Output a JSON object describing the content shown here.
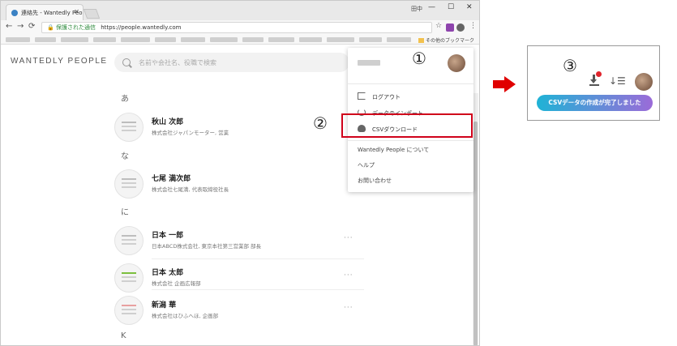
{
  "browser": {
    "tab_title": "連絡先 - Wantedly People",
    "user_label": "田中",
    "secure_label": "保護された通信",
    "url": "https://people.wantedly.com",
    "bookmark_folder": "その他のブックマーク"
  },
  "app": {
    "logo": "WANTEDLY PEOPLE",
    "search_placeholder": "名前や会社名、役職で検索"
  },
  "sections": [
    {
      "letter": "あ",
      "contacts": [
        {
          "name": "秋山 次郎",
          "company": "株式会社ジャパンモーター, 営業"
        }
      ]
    },
    {
      "letter": "な",
      "contacts": [
        {
          "name": "七尾 満次郎",
          "company": "株式会社七尾満, 代表取締役社長"
        }
      ]
    },
    {
      "letter": "に",
      "contacts": [
        {
          "name": "日本 一郎",
          "company": "日本ABCD株式会社, 東京本社第三営業部 部長"
        },
        {
          "name": "日本 太郎",
          "company": "株式会社 企画広報部"
        },
        {
          "name": "新潟 華",
          "company": "株式会社はひふへほ, 企画部"
        }
      ]
    },
    {
      "letter": "K",
      "contacts": []
    }
  ],
  "menu": {
    "logout": "ログアウト",
    "import": "データのインポート",
    "csv_download": "CSVダウンロード",
    "about": "Wantedly People について",
    "help": "ヘルプ",
    "contact": "お問い合わせ"
  },
  "annotations": {
    "step1": "①",
    "step2": "②",
    "step3": "③"
  },
  "panel": {
    "toast": "CSVデータの作成が完了しました"
  },
  "colors": {
    "highlight": "#d0021b",
    "arrow": "#e00000",
    "toast_start": "#1fb3d6",
    "toast_end": "#9b6bd8"
  }
}
